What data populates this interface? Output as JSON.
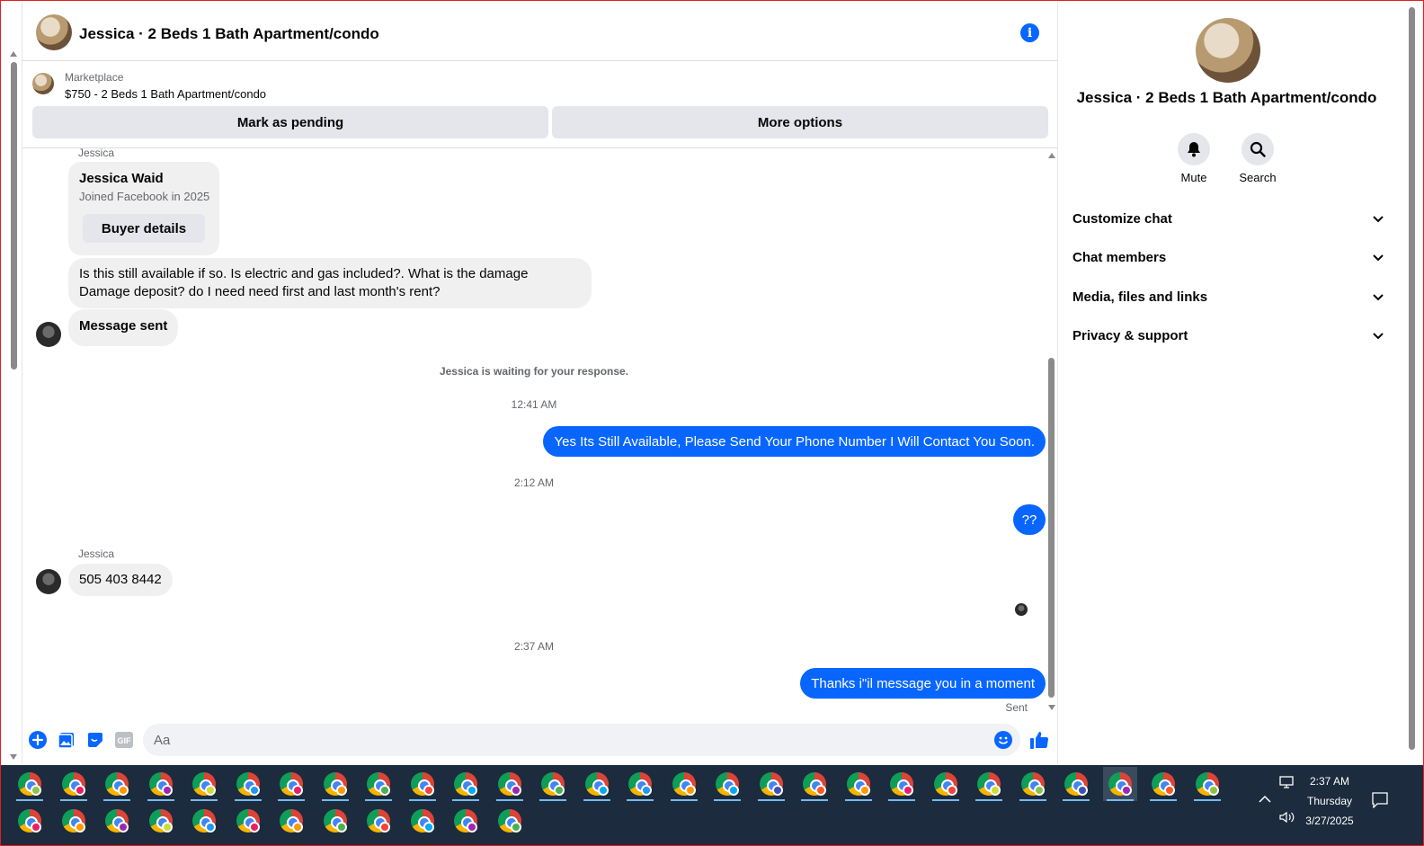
{
  "header": {
    "title": "Jessica · 2 Beds 1 Bath Apartment/condo"
  },
  "marketplace": {
    "label": "Marketplace",
    "listing": "$750 - 2 Beds 1 Bath Apartment/condo",
    "mark_pending": "Mark as pending",
    "more_options": "More options"
  },
  "messages": {
    "sender_top": "Jessica",
    "buyer_card": {
      "name": "Jessica Waid",
      "joined": "Joined Facebook in 2025",
      "button": "Buyer details"
    },
    "msg1": "Is this still available if so. Is electric and gas included?. What is the damage Damage deposit? do I need need first and last month's rent?",
    "msg2": "Message sent",
    "notice": "Jessica is waiting for your response.",
    "time1": "12:41 AM",
    "out1": "Yes Its Still Available, Please Send Your Phone Number I Will Contact You Soon.",
    "time2": "2:12 AM",
    "out2": "??",
    "sender2": "Jessica",
    "msg3": "505 403 8442",
    "time3": "2:37 AM",
    "out3": "Thanks i\"il message you in a moment",
    "sent_label": "Sent"
  },
  "composer": {
    "placeholder": "Aa"
  },
  "panel": {
    "title": "Jessica · 2 Beds 1 Bath Apartment/condo",
    "mute": "Mute",
    "search": "Search",
    "sections": [
      "Customize chat",
      "Chat members",
      "Media, files and links",
      "Privacy & support"
    ]
  },
  "taskbar": {
    "time": "2:37 AM",
    "day": "Thursday",
    "date": "3/27/2025"
  },
  "colors": {
    "accent": "#0866ff",
    "bubble_in": "#f0f0f0",
    "taskbar": "#1c2b3d"
  }
}
